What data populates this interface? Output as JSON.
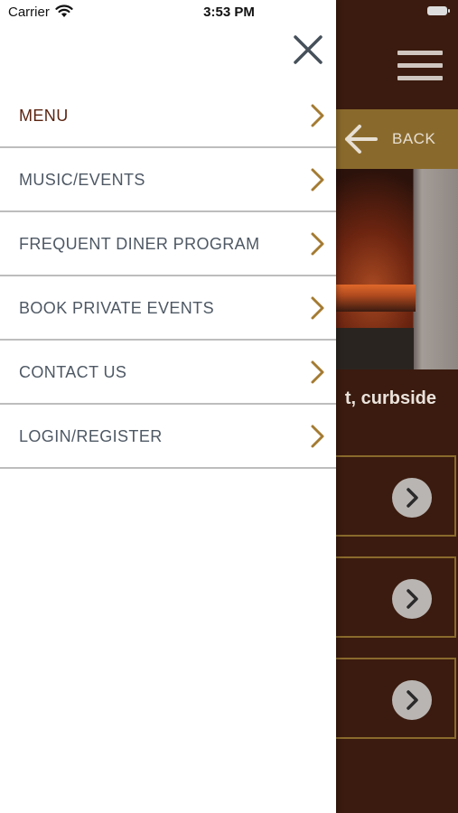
{
  "status_bar": {
    "carrier": "Carrier",
    "time": "3:53 PM",
    "icons": [
      "wifi-icon",
      "battery-icon"
    ]
  },
  "drawer": {
    "close_icon": "close-icon",
    "items": [
      {
        "label": "MENU",
        "active": true,
        "icon": "chevron-right-icon"
      },
      {
        "label": "MUSIC/EVENTS",
        "active": false,
        "icon": "chevron-right-icon"
      },
      {
        "label": "FREQUENT DINER PROGRAM",
        "active": false,
        "icon": "chevron-right-icon"
      },
      {
        "label": "BOOK PRIVATE EVENTS",
        "active": false,
        "icon": "chevron-right-icon"
      },
      {
        "label": "CONTACT US",
        "active": false,
        "icon": "chevron-right-icon"
      },
      {
        "label": "LOGIN/REGISTER",
        "active": false,
        "icon": "chevron-right-icon"
      }
    ]
  },
  "background_app": {
    "menu_icon": "hamburger-icon",
    "back_label": "BACK",
    "caption_visible": "t, curbside",
    "cards": [
      {
        "icon": "chevron-right-circle-icon"
      },
      {
        "icon": "chevron-right-circle-icon"
      },
      {
        "icon": "chevron-right-circle-icon"
      }
    ]
  },
  "colors": {
    "background_brown": "#3b1b0f",
    "accent_gold": "#a47b32",
    "drawer_text": "#4e5864",
    "active_text": "#5a2410",
    "back_bar": "#8a6a2c"
  }
}
